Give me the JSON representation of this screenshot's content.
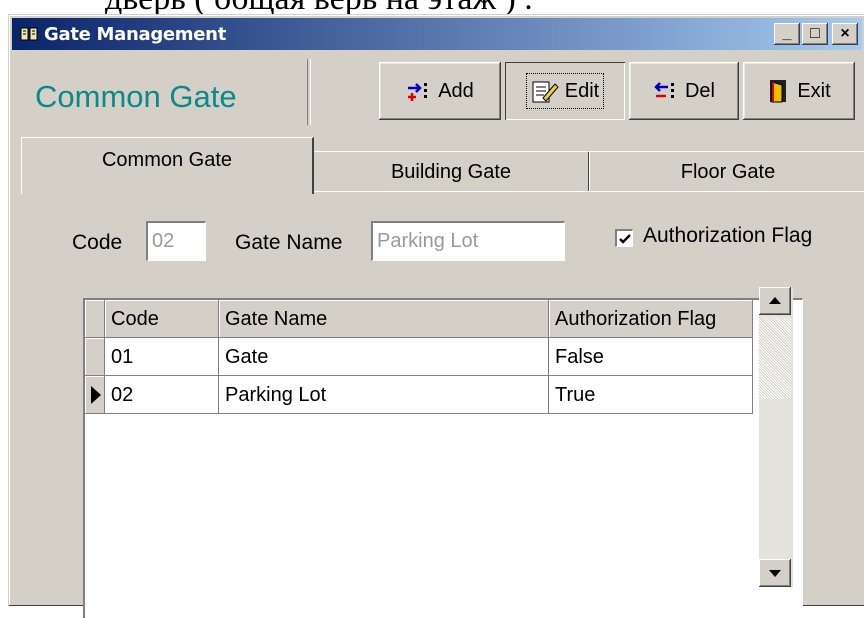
{
  "document": {
    "overflow_text": "дверь ( общая верь на этаж ) ."
  },
  "window": {
    "title": "Gate Management",
    "controls": {
      "minimize": "_",
      "maximize": "□",
      "close": "×"
    }
  },
  "header": {
    "title": "Common Gate"
  },
  "toolbar": {
    "add_label": "Add",
    "edit_label": "Edit",
    "delete_label": "Del",
    "exit_label": "Exit"
  },
  "tabs": [
    {
      "label": "Common Gate",
      "active": true
    },
    {
      "label": "Building Gate",
      "active": false
    },
    {
      "label": "Floor Gate",
      "active": false
    }
  ],
  "form": {
    "code_label": "Code",
    "code_value": "02",
    "gate_name_label": "Gate Name",
    "gate_name_value": "Parking Lot",
    "authorization_label": "Authorization Flag",
    "authorization_checked": true
  },
  "grid": {
    "columns": [
      "Code",
      "Gate Name",
      "Authorization Flag"
    ],
    "rows": [
      {
        "code": "01",
        "gate_name": "Gate",
        "authorization_flag": "False",
        "current": false
      },
      {
        "code": "02",
        "gate_name": "Parking Lot",
        "authorization_flag": "True",
        "current": true
      }
    ]
  },
  "colors": {
    "accent_title": "#0b8a8a",
    "titlebar_start": "#0a246a",
    "titlebar_end": "#a6caf0",
    "face": "#d4d0c8"
  }
}
